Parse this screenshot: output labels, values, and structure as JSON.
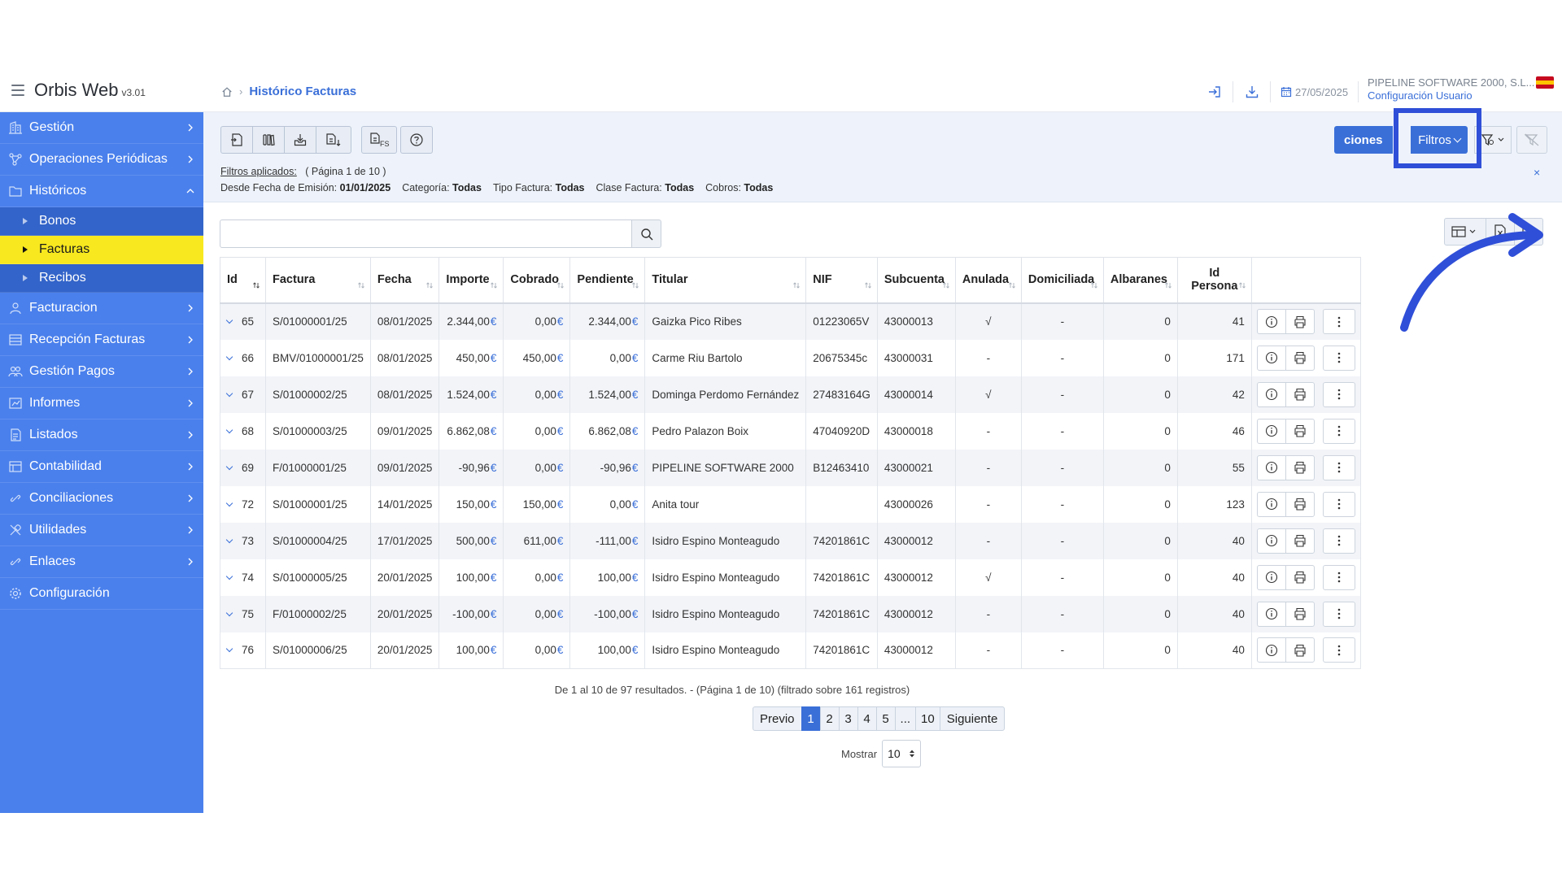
{
  "app": {
    "title": "Orbis Web",
    "version": "v3.01"
  },
  "breadcrumb": {
    "current": "Histórico Facturas"
  },
  "header": {
    "date": "27/05/2025",
    "company": "PIPELINE SOFTWARE 2000, S.L...",
    "user_config": "Configuración Usuario"
  },
  "sidebar": {
    "items": [
      {
        "label": "Gestión",
        "icon": "building-icon"
      },
      {
        "label": "Operaciones Periódicas",
        "icon": "network-icon"
      },
      {
        "label": "Históricos",
        "icon": "folder-icon",
        "expanded": true
      },
      {
        "label": "Facturacion",
        "icon": "user-icon"
      },
      {
        "label": "Recepción Facturas",
        "icon": "inbox-icon"
      },
      {
        "label": "Gestión Pagos",
        "icon": "users-icon"
      },
      {
        "label": "Informes",
        "icon": "report-icon"
      },
      {
        "label": "Listados",
        "icon": "list-icon"
      },
      {
        "label": "Contabilidad",
        "icon": "ledger-icon"
      },
      {
        "label": "Conciliaciones",
        "icon": "link-icon"
      },
      {
        "label": "Utilidades",
        "icon": "tools-icon"
      },
      {
        "label": "Enlaces",
        "icon": "link-icon"
      },
      {
        "label": "Configuración",
        "icon": "gear-icon"
      }
    ],
    "sub_items": [
      {
        "label": "Bonos"
      },
      {
        "label": "Facturas",
        "active": true
      },
      {
        "label": "Recibos"
      }
    ]
  },
  "toolbar": {
    "opciones_label": "ciones",
    "filtros_label": "Filtros"
  },
  "filters": {
    "applied_label": "Filtros aplicados:",
    "page_info": "( Página 1 de 10 )",
    "items": [
      {
        "key": "Desde Fecha de Emisión:",
        "value": "01/01/2025"
      },
      {
        "key": "Categoría:",
        "value": "Todas"
      },
      {
        "key": "Tipo Factura:",
        "value": "Todas"
      },
      {
        "key": "Clase Factura:",
        "value": "Todas"
      },
      {
        "key": "Cobros:",
        "value": "Todas"
      }
    ],
    "close": "×"
  },
  "search": {
    "placeholder": "",
    "value": ""
  },
  "table": {
    "columns": [
      "Id",
      "Factura",
      "Fecha",
      "Importe",
      "Cobrado",
      "Pendiente",
      "Titular",
      "NIF",
      "Subcuenta",
      "Anulada",
      "Domiciliada",
      "Albaranes",
      "Id Persona"
    ],
    "currency": "€",
    "rows": [
      {
        "id": "65",
        "factura": "S/01000001/25",
        "fecha": "08/01/2025",
        "importe": "2.344,00",
        "cobrado": "0,00",
        "pendiente": "2.344,00",
        "titular": "Gaizka Pico Ribes",
        "nif": "01223065V",
        "subcuenta": "43000013",
        "anulada": "√",
        "domiciliada": "-",
        "albaranes": "0",
        "persona": "41"
      },
      {
        "id": "66",
        "factura": "BMV/01000001/25",
        "fecha": "08/01/2025",
        "importe": "450,00",
        "cobrado": "450,00",
        "pendiente": "0,00",
        "titular": "Carme Riu Bartolo",
        "nif": "20675345c",
        "subcuenta": "43000031",
        "anulada": "-",
        "domiciliada": "-",
        "albaranes": "0",
        "persona": "171"
      },
      {
        "id": "67",
        "factura": "S/01000002/25",
        "fecha": "08/01/2025",
        "importe": "1.524,00",
        "cobrado": "0,00",
        "pendiente": "1.524,00",
        "titular": "Dominga Perdomo Fernández",
        "nif": "27483164G",
        "subcuenta": "43000014",
        "anulada": "√",
        "domiciliada": "-",
        "albaranes": "0",
        "persona": "42"
      },
      {
        "id": "68",
        "factura": "S/01000003/25",
        "fecha": "09/01/2025",
        "importe": "6.862,08",
        "cobrado": "0,00",
        "pendiente": "6.862,08",
        "titular": "Pedro Palazon Boix",
        "nif": "47040920D",
        "subcuenta": "43000018",
        "anulada": "-",
        "domiciliada": "-",
        "albaranes": "0",
        "persona": "46"
      },
      {
        "id": "69",
        "factura": "F/01000001/25",
        "fecha": "09/01/2025",
        "importe": "-90,96",
        "cobrado": "0,00",
        "pendiente": "-90,96",
        "titular": "PIPELINE SOFTWARE 2000",
        "nif": "B12463410",
        "subcuenta": "43000021",
        "anulada": "-",
        "domiciliada": "-",
        "albaranes": "0",
        "persona": "55"
      },
      {
        "id": "72",
        "factura": "S/01000001/25",
        "fecha": "14/01/2025",
        "importe": "150,00",
        "cobrado": "150,00",
        "pendiente": "0,00",
        "titular": "Anita tour",
        "nif": "",
        "subcuenta": "43000026",
        "anulada": "-",
        "domiciliada": "-",
        "albaranes": "0",
        "persona": "123"
      },
      {
        "id": "73",
        "factura": "S/01000004/25",
        "fecha": "17/01/2025",
        "importe": "500,00",
        "cobrado": "611,00",
        "pendiente": "-111,00",
        "titular": "Isidro Espino Monteagudo",
        "nif": "74201861C",
        "subcuenta": "43000012",
        "anulada": "-",
        "domiciliada": "-",
        "albaranes": "0",
        "persona": "40"
      },
      {
        "id": "74",
        "factura": "S/01000005/25",
        "fecha": "20/01/2025",
        "importe": "100,00",
        "cobrado": "0,00",
        "pendiente": "100,00",
        "titular": "Isidro Espino Monteagudo",
        "nif": "74201861C",
        "subcuenta": "43000012",
        "anulada": "√",
        "domiciliada": "-",
        "albaranes": "0",
        "persona": "40"
      },
      {
        "id": "75",
        "factura": "F/01000002/25",
        "fecha": "20/01/2025",
        "importe": "-100,00",
        "cobrado": "0,00",
        "pendiente": "-100,00",
        "titular": "Isidro Espino Monteagudo",
        "nif": "74201861C",
        "subcuenta": "43000012",
        "anulada": "-",
        "domiciliada": "-",
        "albaranes": "0",
        "persona": "40"
      },
      {
        "id": "76",
        "factura": "S/01000006/25",
        "fecha": "20/01/2025",
        "importe": "100,00",
        "cobrado": "0,00",
        "pendiente": "100,00",
        "titular": "Isidro Espino Monteagudo",
        "nif": "74201861C",
        "subcuenta": "43000012",
        "anulada": "-",
        "domiciliada": "-",
        "albaranes": "0",
        "persona": "40"
      }
    ]
  },
  "pagination": {
    "summary": "De 1 al 10 de 97 resultados. - (Página 1 de 10) (filtrado sobre 161 registros)",
    "prev": "Previo",
    "next": "Siguiente",
    "pages": [
      "1",
      "2",
      "3",
      "4",
      "5",
      "...",
      "10"
    ],
    "active": "1",
    "show_label": "Mostrar",
    "show_value": "10"
  },
  "colors": {
    "accent": "#3a6fd8",
    "sidebar": "#4a80ec",
    "active_item": "#f7e81f",
    "annotation": "#2f4fd8"
  }
}
